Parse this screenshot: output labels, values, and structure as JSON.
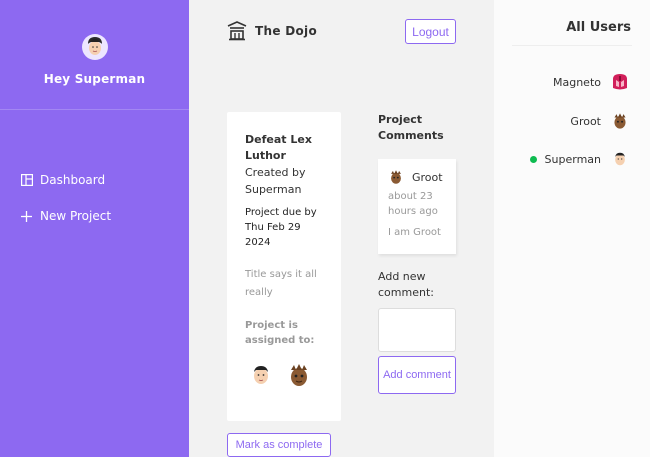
{
  "sidebar": {
    "greeting": "Hey Superman",
    "nav": [
      {
        "label": "Dashboard",
        "icon": "dashboard-icon"
      },
      {
        "label": "New Project",
        "icon": "plus-icon"
      }
    ]
  },
  "navbar": {
    "brand": "The Dojo",
    "logout_label": "Logout"
  },
  "project": {
    "name": "Defeat Lex Luthor",
    "created_by": "Created by Superman",
    "due": "Project due by Thu Feb 29 2024",
    "details": "Title says it all really",
    "assigned_label": "Project is assigned to:",
    "complete_label": "Mark as complete"
  },
  "comments": {
    "heading": "Project Comments",
    "items": [
      {
        "author": "Groot",
        "date": "about 23 hours ago",
        "text": "I am Groot"
      }
    ],
    "add_label": "Add new comment:",
    "add_button": "Add comment"
  },
  "users": {
    "heading": "All Users",
    "list": [
      {
        "name": "Magneto",
        "online": false
      },
      {
        "name": "Groot",
        "online": false
      },
      {
        "name": "Superman",
        "online": true
      }
    ]
  },
  "colors": {
    "accent": "#8d69f1",
    "online": "#0ebb50"
  }
}
